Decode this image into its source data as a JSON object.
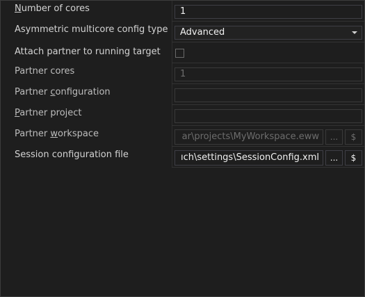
{
  "properties": {
    "number_of_cores": {
      "label_pre": "",
      "label_key": "N",
      "label_post": "umber of cores",
      "value": "1"
    },
    "asymmetric_config": {
      "label": "Asymmetric multicore config type",
      "value": "Advanced"
    },
    "attach_partner": {
      "label": "Attach partner to running target",
      "checked": false
    },
    "partner_cores": {
      "label": "Partner cores",
      "value": "1"
    },
    "partner_configuration": {
      "label_pre": "Partner ",
      "label_key": "c",
      "label_post": "onfiguration",
      "value": ""
    },
    "partner_project": {
      "label_pre": "",
      "label_key": "P",
      "label_post": "artner project",
      "value": ""
    },
    "partner_workspace": {
      "label_pre": "Partner ",
      "label_key": "w",
      "label_post": "orkspace",
      "value": "ar\\projects\\MyWorkspace.eww",
      "browse_label": "...",
      "macro_label": "$"
    },
    "session_config_file": {
      "label": "Session configuration file",
      "value": "ıch\\settings\\SessionConfig.xml",
      "browse_label": "...",
      "macro_label": "$"
    }
  }
}
